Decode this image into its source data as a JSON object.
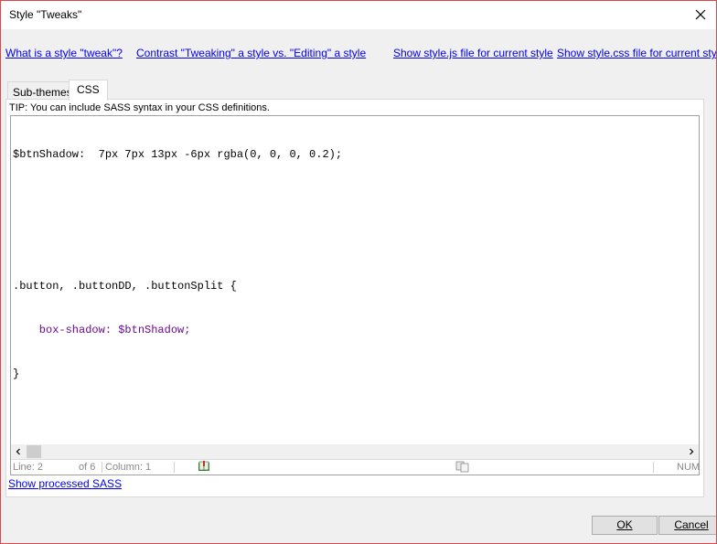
{
  "window": {
    "title": "Style \"Tweaks\""
  },
  "links": {
    "what_is_tweak": "What is a style \"tweak\"?",
    "contrast": "Contrast \"Tweaking\" a style vs. \"Editing\" a style",
    "show_js": "Show style.js file for current style",
    "show_css": "Show style.css file for current style"
  },
  "tabs": [
    {
      "label": "Sub-themes"
    },
    {
      "label": "CSS"
    }
  ],
  "tip": "TIP: You can include SASS syntax in your CSS definitions.",
  "code": {
    "line1": "$btnShadow:  7px 7px 13px -6px rgba(0, 0, 0, 0.2);",
    "line2": "",
    "line3": "",
    "line4": ".button, .buttonDD, .buttonSplit {",
    "line5_prop": "    box-shadow: ",
    "line5_value": "$btnShadow;",
    "line6": "}"
  },
  "statusbar": {
    "line": "Line: 2",
    "of": "of 6",
    "column": "Column: 1",
    "num": "NUM"
  },
  "show_processed_sass": "Show processed SASS",
  "buttons": {
    "ok": "OK",
    "cancel": "Cancel"
  }
}
